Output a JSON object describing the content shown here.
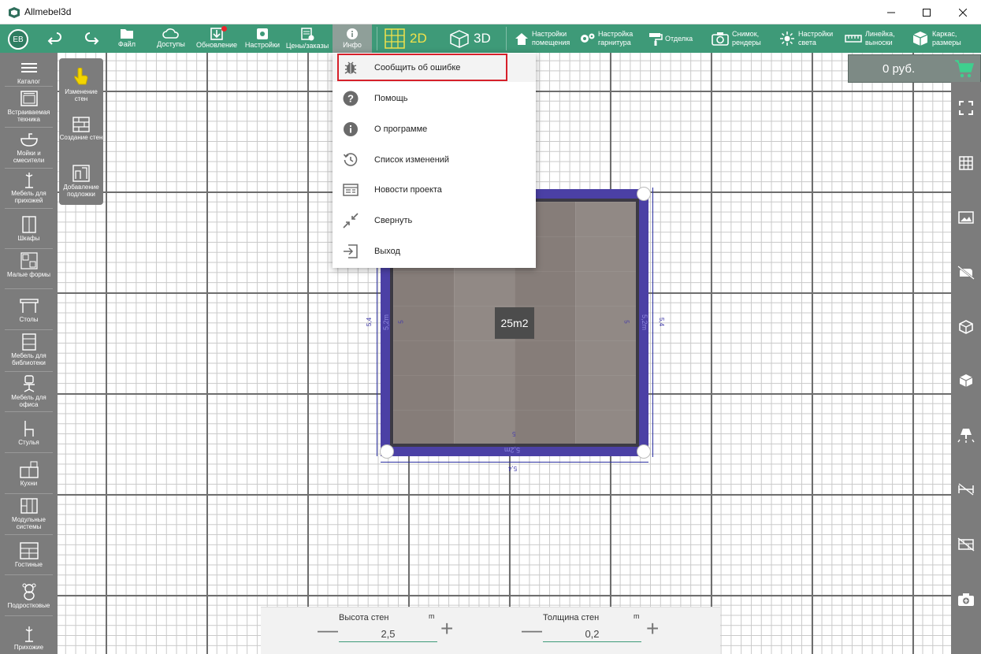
{
  "app": {
    "title": "Allmebel3d"
  },
  "user": {
    "initials": "ЕВ"
  },
  "toolbar": {
    "file": "Файл",
    "access": "Доступы",
    "update": "Обновление",
    "settings": "Настройки",
    "prices": "Цены/заказы",
    "info": "Инфо",
    "mode_2d": "2D",
    "mode_3d": "3D",
    "room_settings_l1": "Настройки",
    "room_settings_l2": "помещения",
    "set_settings_l1": "Настройка",
    "set_settings_l2": "гарнитура",
    "finish": "Отделка",
    "snapshot_l1": "Снимок,",
    "snapshot_l2": "рендеры",
    "light_l1": "Настройки",
    "light_l2": "света",
    "ruler_l1": "Линейка,",
    "ruler_l2": "выноски",
    "frame_l1": "Каркас,",
    "frame_l2": "размеры"
  },
  "sidebar": {
    "items": [
      {
        "label": "Каталог"
      },
      {
        "label": "Встраиваемая техника"
      },
      {
        "label": "Мойки и смесители"
      },
      {
        "label": "Мебель для прихожей"
      },
      {
        "label": "Шкафы"
      },
      {
        "label": "Малые формы"
      },
      {
        "label": "Столы"
      },
      {
        "label": "Мебель для библиотеки"
      },
      {
        "label": "Мебель для офиса"
      },
      {
        "label": "Стулья"
      },
      {
        "label": "Кухни"
      },
      {
        "label": "Модульные системы"
      },
      {
        "label": "Гостиные"
      },
      {
        "label": "Подростковые"
      },
      {
        "label": "Прихожие"
      }
    ]
  },
  "tools": {
    "edit_walls": "Изменение стен",
    "create_walls": "Создание стен",
    "add_underlay": "Добавление подложки"
  },
  "price": {
    "value": "0 руб."
  },
  "menu": {
    "items": [
      {
        "label": "Сообщить об ошибке",
        "icon": "bug-icon"
      },
      {
        "label": "Помощь",
        "icon": "help-icon"
      },
      {
        "label": "О программе",
        "icon": "info-icon"
      },
      {
        "label": "Список изменений",
        "icon": "history-icon"
      },
      {
        "label": "Новости проекта",
        "icon": "news-icon"
      },
      {
        "label": "Свернуть",
        "icon": "minimize-icon"
      },
      {
        "label": "Выход",
        "icon": "exit-icon"
      }
    ]
  },
  "room": {
    "area": "25m2",
    "dim_outer": "5,4",
    "dim_wall": "5,2m",
    "dim_inner": "5"
  },
  "bottom": {
    "wall_height_label": "Высота стен",
    "wall_height_value": "2,5",
    "wall_thickness_label": "Толщина стен",
    "wall_thickness_value": "0,2",
    "unit": "m"
  },
  "colors": {
    "accent": "#3e9a78",
    "sidebar": "#7c7c7c",
    "highlight": "#d6202a",
    "wall": "#4b40a5"
  }
}
